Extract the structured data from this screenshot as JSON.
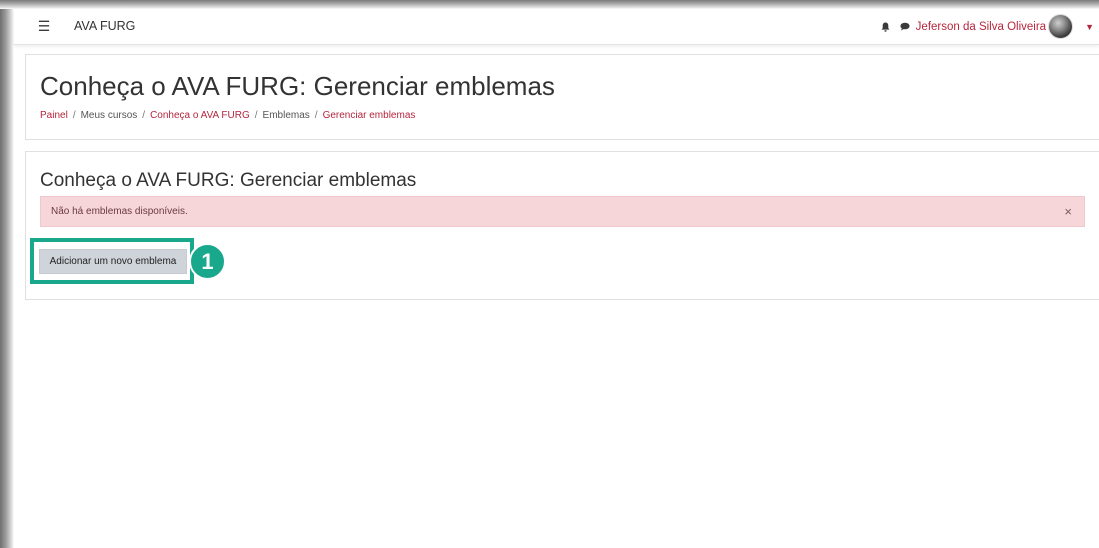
{
  "navbar": {
    "site_name": "AVA FURG",
    "user_name": "Jeferson da Silva Oliveira",
    "icons": [
      "hamburger-icon",
      "bell-icon",
      "chat-icon",
      "avatar",
      "caret-down-icon"
    ]
  },
  "header": {
    "title": "Conheça o AVA FURG: Gerenciar emblemas",
    "breadcrumb": [
      "Painel",
      "Meus cursos",
      "Conheça o AVA FURG",
      "Emblemas",
      "Gerenciar emblemas"
    ]
  },
  "main": {
    "title": "Conheça o AVA FURG: Gerenciar emblemas",
    "alert_text": "Não há emblemas disponíveis.",
    "alert_close": "×",
    "add_button_label": "Adicionar um novo emblema",
    "step_badge": "1"
  },
  "colors": {
    "accent": "#b5263d",
    "highlight": "#1aa88d",
    "alert_bg": "#f6d6d9",
    "button_bg": "#ced4da"
  }
}
